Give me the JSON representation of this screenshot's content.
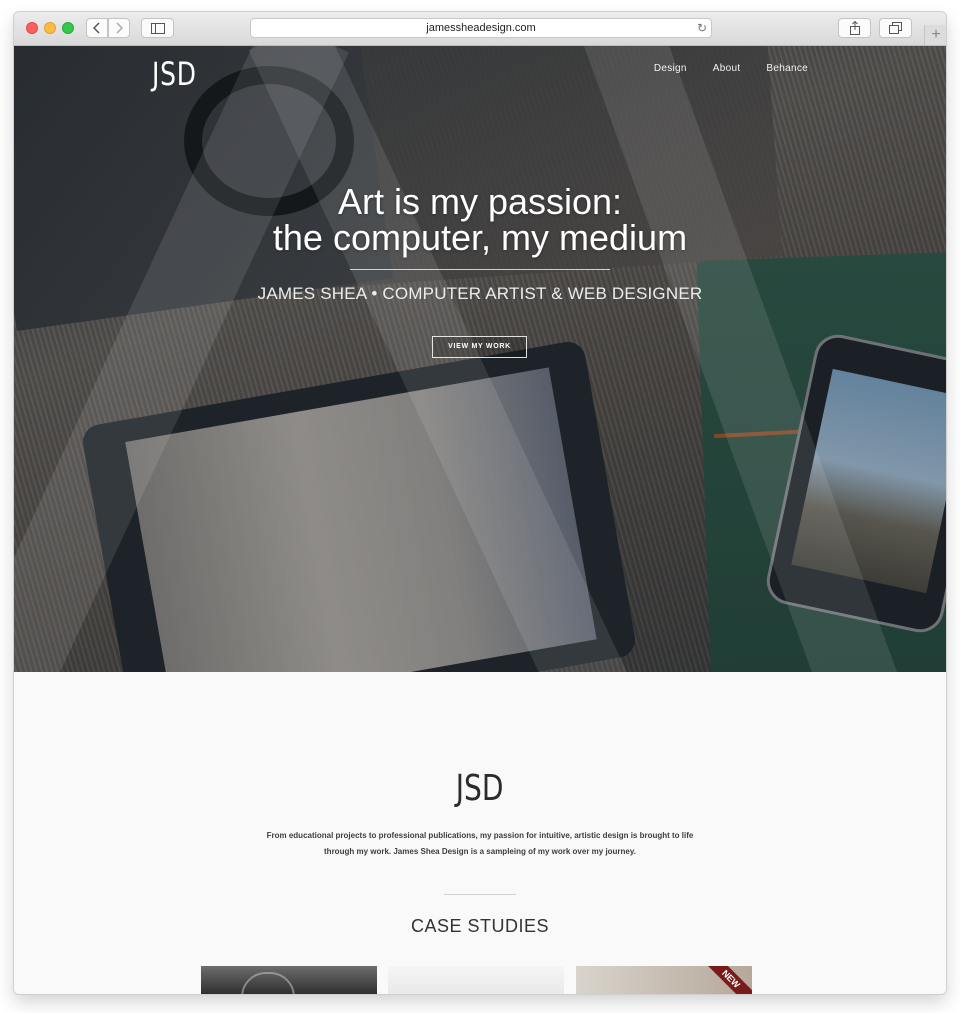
{
  "browser": {
    "url": "jamessheadesign.com",
    "newtab_symbol": "+"
  },
  "site": {
    "logo": "JSD",
    "nav": [
      {
        "label": "Design"
      },
      {
        "label": "About"
      },
      {
        "label": "Behance"
      }
    ]
  },
  "hero": {
    "headline_line1": "Art is my passion:",
    "headline_line2": "the computer, my medium",
    "subhead": "JAMES SHEA • COMPUTER ARTIST & WEB DESIGNER",
    "cta_label": "VIEW MY WORK"
  },
  "intro": {
    "logo": "JSD",
    "text": "From educational projects to professional publications, my passion for intuitive, artistic design is brought to life through my work. James Shea Design is a sampleing of my work over my journey."
  },
  "case_studies": {
    "title": "CASE STUDIES",
    "badge": "NEW"
  }
}
